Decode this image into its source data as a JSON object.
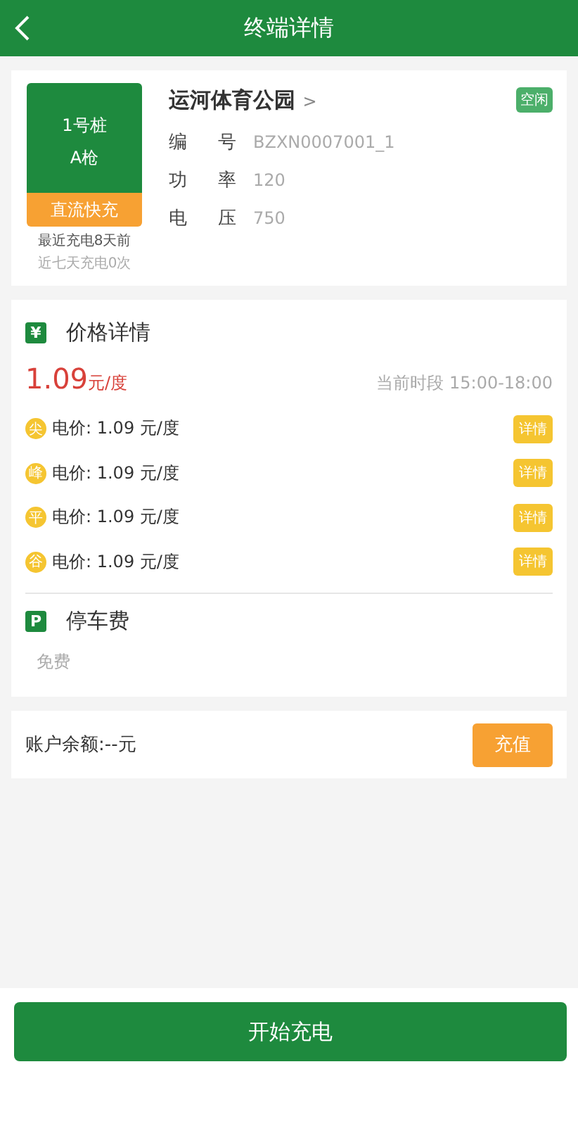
{
  "header": {
    "title": "终端详情"
  },
  "pile": {
    "name": "1号桩",
    "gun": "A枪",
    "type": "直流快充",
    "last_charge": "最近充电8天前",
    "week_count": "近七天充电0次"
  },
  "station": {
    "name": "运河体育公园",
    "arrow": ">",
    "status": "空闲",
    "fields": [
      {
        "label": "编 号",
        "value": "BZXN0007001_1"
      },
      {
        "label": "功 率",
        "value": "120"
      },
      {
        "label": "电 压",
        "value": "750"
      }
    ]
  },
  "price": {
    "icon": "¥",
    "title": "价格详情",
    "amount": "1.09",
    "unit": "元/度",
    "period": "当前时段 15:00-18:00",
    "tiers": [
      {
        "badge": "尖",
        "text": "电价: 1.09 元/度",
        "button": "详情"
      },
      {
        "badge": "峰",
        "text": "电价: 1.09 元/度",
        "button": "详情"
      },
      {
        "badge": "平",
        "text": "电价: 1.09 元/度",
        "button": "详情"
      },
      {
        "badge": "谷",
        "text": "电价: 1.09 元/度",
        "button": "详情"
      }
    ]
  },
  "parking": {
    "icon": "P",
    "title": "停车费",
    "value": "免费"
  },
  "account": {
    "balance": "账户余额:--元",
    "button": "充值"
  },
  "start_button": "开始充电"
}
